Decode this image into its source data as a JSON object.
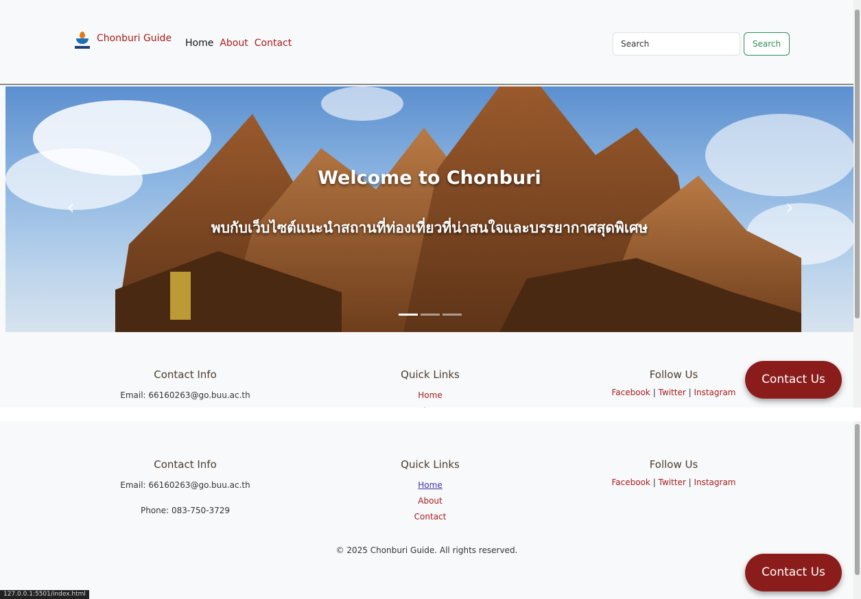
{
  "navbar": {
    "brand": "Chonburi Guide",
    "links": [
      {
        "label": "Home",
        "active": true
      },
      {
        "label": "About",
        "active": false
      },
      {
        "label": "Contact",
        "active": false
      }
    ],
    "search_placeholder": "Search",
    "search_button": "Search"
  },
  "hero": {
    "title": "Welcome to Chonburi",
    "subtitle": "พบกับเว็บไซต์แนะนำสถานที่ท่องเที่ยวที่น่าสนใจและบรรยากาศสุดพิเศษ",
    "prev_icon": "chevron-left-icon",
    "next_icon": "chevron-right-icon",
    "slide_count": 3,
    "active_slide": 1
  },
  "footer": {
    "contact": {
      "heading": "Contact Info",
      "email": "Email: 66160263@go.buu.ac.th",
      "phone": "Phone: 083-750-3729"
    },
    "quick_links": {
      "heading": "Quick Links",
      "items": [
        "Home",
        "About",
        "Contact"
      ]
    },
    "follow": {
      "heading": "Follow Us",
      "facebook": "Facebook",
      "twitter": "Twitter",
      "instagram": "Instagram",
      "separator": " | "
    },
    "copyright": "© 2025 Chonburi Guide. All rights reserved."
  },
  "fab": {
    "label": "Contact Us"
  },
  "status_bar": {
    "url": "127.0.0.1:5501/index.html"
  },
  "colors": {
    "accent": "#a51c1c",
    "fab": "#8b1c1c",
    "search_button": "#2e8b57",
    "visited_link": "#3c2ea8"
  }
}
